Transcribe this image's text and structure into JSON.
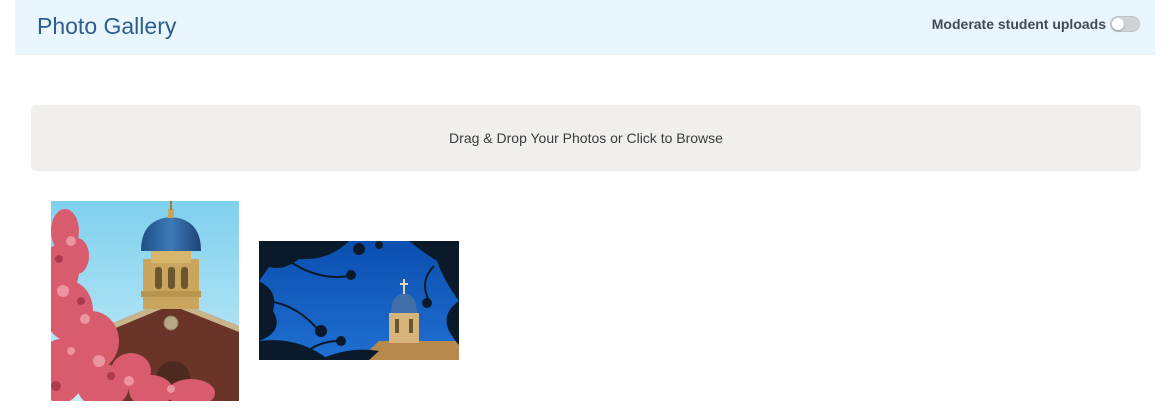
{
  "header": {
    "title": "Photo Gallery",
    "moderate_label": "Moderate student uploads",
    "moderate_enabled": false
  },
  "dropzone": {
    "text": "Drag & Drop Your Photos or Click to Browse"
  },
  "photos": [
    {
      "alt": "Chapel dome behind pink blossoms"
    },
    {
      "alt": "Chapel tower framed by tree branches"
    }
  ],
  "colors": {
    "header_bg": "#e9f6fd",
    "title": "#2d5c8f",
    "dropzone_bg": "#f0efee"
  }
}
